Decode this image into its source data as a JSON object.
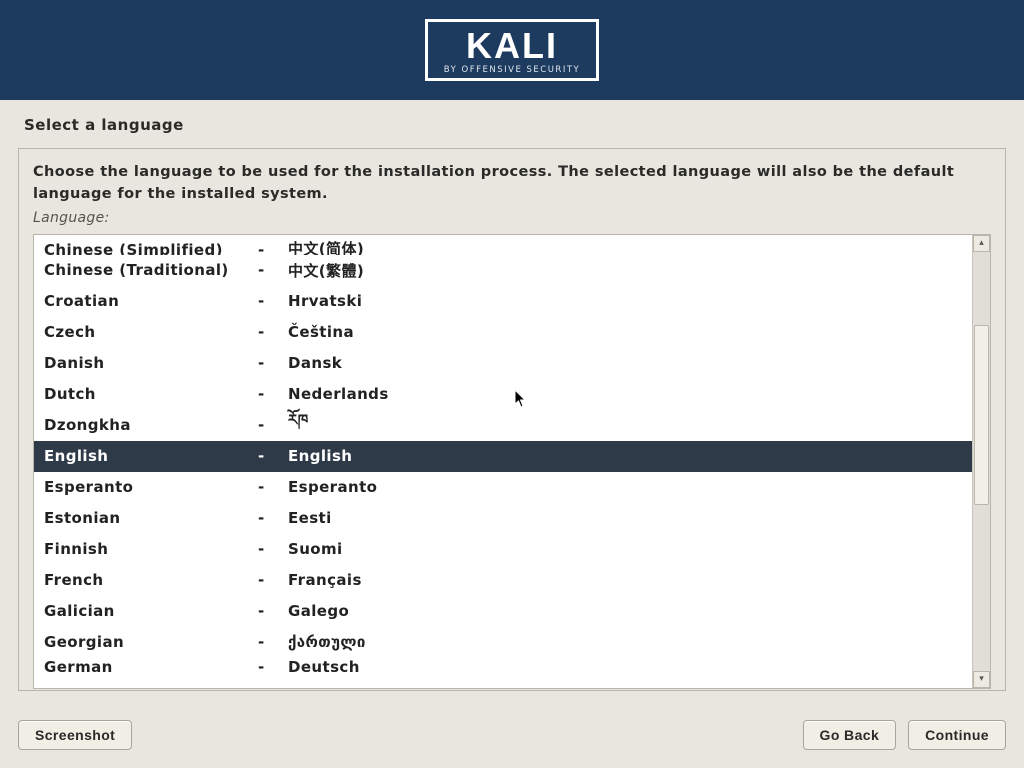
{
  "header": {
    "logo_title": "KALI",
    "logo_sub": "BY OFFENSIVE SECURITY"
  },
  "page_title": "Select a language",
  "instruction": "Choose the language to be used for the installation process. The selected language will also be the default language for the installed system.",
  "field_label": "Language:",
  "languages": [
    {
      "name": "Chinese (Simplified)",
      "native": "中文(简体)"
    },
    {
      "name": "Chinese (Traditional)",
      "native": "中文(繁體)"
    },
    {
      "name": "Croatian",
      "native": "Hrvatski"
    },
    {
      "name": "Czech",
      "native": "Čeština"
    },
    {
      "name": "Danish",
      "native": "Dansk"
    },
    {
      "name": "Dutch",
      "native": "Nederlands"
    },
    {
      "name": "Dzongkha",
      "native": "རོཁ"
    },
    {
      "name": "English",
      "native": "English"
    },
    {
      "name": "Esperanto",
      "native": "Esperanto"
    },
    {
      "name": "Estonian",
      "native": "Eesti"
    },
    {
      "name": "Finnish",
      "native": "Suomi"
    },
    {
      "name": "French",
      "native": "Français"
    },
    {
      "name": "Galician",
      "native": "Galego"
    },
    {
      "name": "Georgian",
      "native": "ქართული"
    },
    {
      "name": "German",
      "native": "Deutsch"
    }
  ],
  "selected_index": 7,
  "buttons": {
    "screenshot": "Screenshot",
    "go_back": "Go Back",
    "continue": "Continue"
  },
  "dash": "-"
}
